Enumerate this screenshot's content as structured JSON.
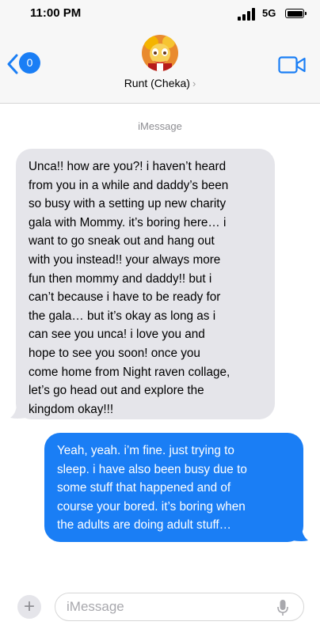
{
  "status_bar": {
    "time": "11:00 PM",
    "network": "5G",
    "signal_bars": 4,
    "battery_level": 1.0
  },
  "header": {
    "back_badge": "0",
    "contact_name": "Runt (Cheka)",
    "chevron": "›",
    "icons": {
      "back": "chevron-left-icon",
      "video": "video-camera-icon",
      "avatar": "contact-avatar"
    },
    "accent_color": "#1a7ef5"
  },
  "conversation": {
    "service_label": "iMessage",
    "messages": [
      {
        "direction": "incoming",
        "lines": [
          "Unca!! how are you?! i haven’t heard",
          "from you in a while and daddy’s been",
          "so busy with a setting up new charity",
          "gala with Mommy. it’s boring here… i",
          "want to go sneak out and hang out",
          "with you instead!! your always more",
          "fun then mommy and daddy!! but i",
          "can’t because i have to be ready for",
          "the gala… but it’s okay as long as i",
          "can see you unca! i love you and",
          "hope to see you soon! once you",
          "come home from Night raven collage,",
          "let’s go head out and explore the",
          "kingdom okay!!!"
        ]
      },
      {
        "direction": "outgoing",
        "lines": [
          "Yeah, yeah. i’m fine. just trying to",
          "sleep. i have also been busy due to",
          "some stuff that happened and of",
          "course your bored. it’s boring when",
          "the adults are doing adult stuff…"
        ]
      }
    ]
  },
  "composer": {
    "plus_label": "+",
    "placeholder": "iMessage",
    "icons": {
      "apps": "plus-icon",
      "mic": "microphone-icon"
    }
  }
}
